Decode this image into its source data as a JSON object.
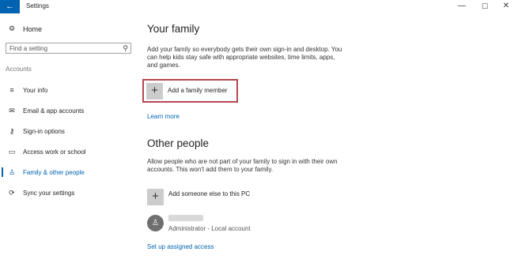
{
  "window": {
    "title": "Settings",
    "back_glyph": "←",
    "minimize_glyph": "—",
    "maximize_glyph": "☐",
    "close_glyph": "✕"
  },
  "sidebar": {
    "home_label": "Home",
    "home_icon": "gear-icon",
    "search": {
      "placeholder": "Find a setting",
      "value": "",
      "icon": "search-icon"
    },
    "section_label": "Accounts",
    "items": [
      {
        "label": "Your info",
        "icon": "person-list-icon",
        "glyph": "≡",
        "active": false
      },
      {
        "label": "Email & app accounts",
        "icon": "mail-icon",
        "glyph": "✉",
        "active": false
      },
      {
        "label": "Sign-in options",
        "icon": "key-icon",
        "glyph": "⚷",
        "active": false
      },
      {
        "label": "Access work or school",
        "icon": "briefcase-icon",
        "glyph": "▭",
        "active": false
      },
      {
        "label": "Family & other people",
        "icon": "person-icon",
        "glyph": "♙",
        "active": true
      },
      {
        "label": "Sync your settings",
        "icon": "sync-icon",
        "glyph": "⟳",
        "active": false
      }
    ]
  },
  "main": {
    "family": {
      "title": "Your family",
      "description": "Add your family so everybody gets their own sign-in and desktop. You can help kids stay safe with appropriate websites, time limits, apps, and games.",
      "add_button_label": "Add a family member",
      "learn_more": "Learn more"
    },
    "other": {
      "title": "Other people",
      "description": "Allow people who are not part of your family to sign in with their own accounts. This won't add them to your family.",
      "add_button_label": "Add someone else to this PC",
      "account": {
        "role": "Administrator - Local account"
      },
      "assigned_access": "Set up assigned access"
    }
  },
  "colors": {
    "accent": "#0063b1",
    "highlight_border": "#b5474f"
  }
}
